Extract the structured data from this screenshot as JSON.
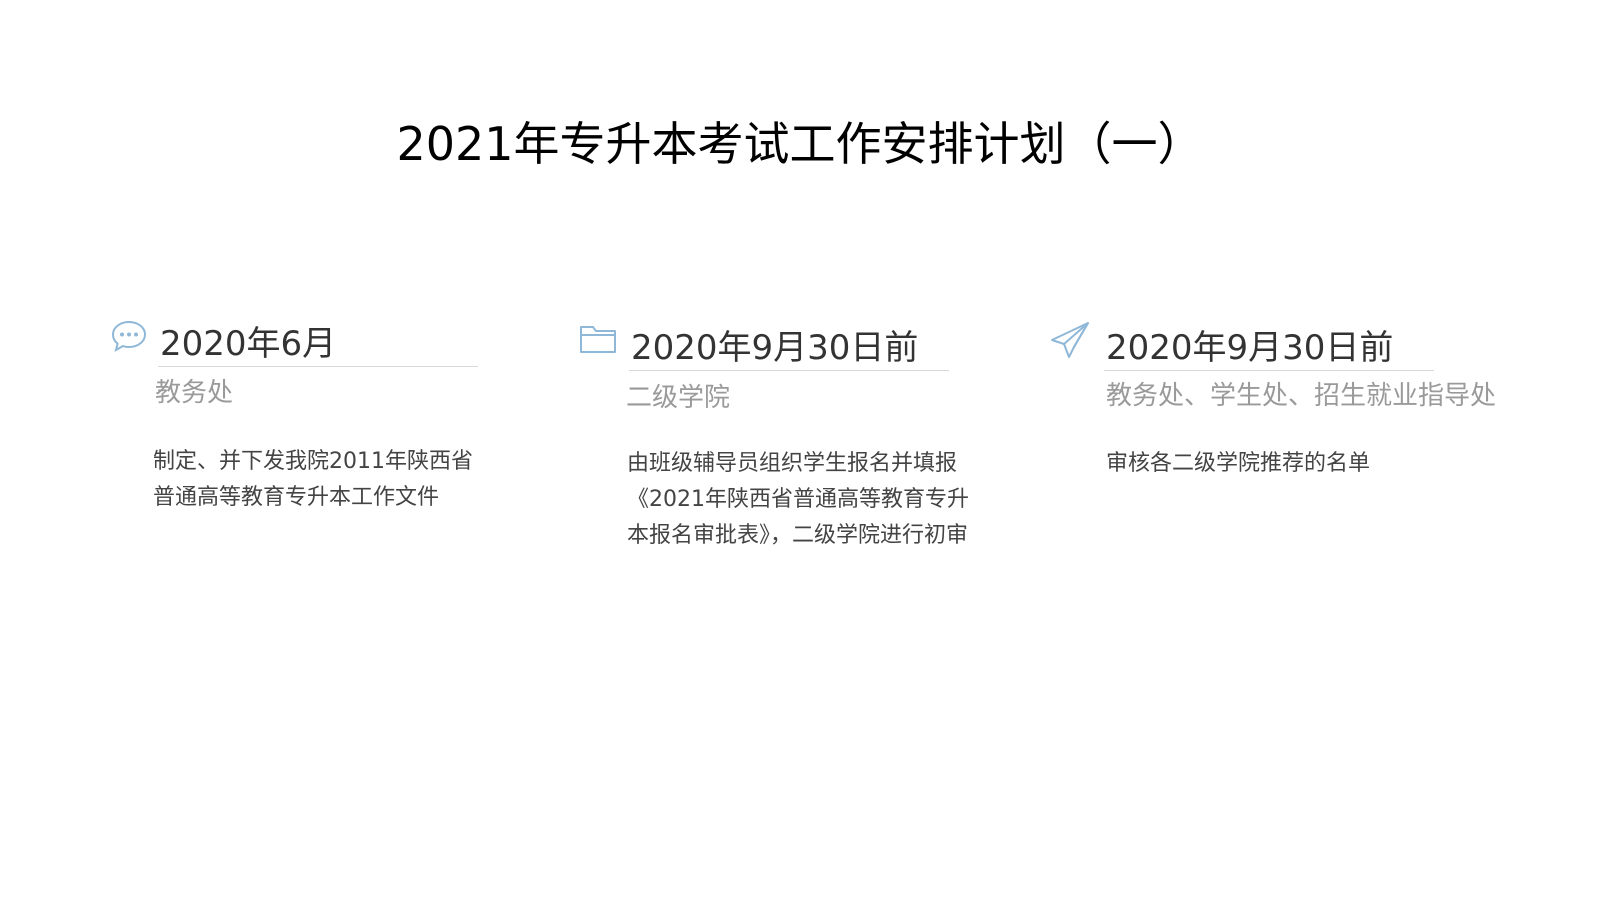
{
  "slide": {
    "title": "2021年专升本考试工作安排计划（一）",
    "accent_color": "#8fb8d8",
    "cards": [
      {
        "icon": "chat-bubble-icon",
        "date": "2020年6月",
        "department": "教务处",
        "description": "制定、并下发我院2011年陕西省普通高等教育专升本工作文件"
      },
      {
        "icon": "folder-icon",
        "date": "2020年9月30日前",
        "department": "二级学院",
        "description": "由班级辅导员组织学生报名并填报《2021年陕西省普通高等教育专升本报名审批表》，二级学院进行初审"
      },
      {
        "icon": "paper-plane-icon",
        "date": "2020年9月30日前",
        "department": "教务处、学生处、招生就业指导处",
        "description": "审核各二级学院推荐的名单"
      }
    ]
  }
}
